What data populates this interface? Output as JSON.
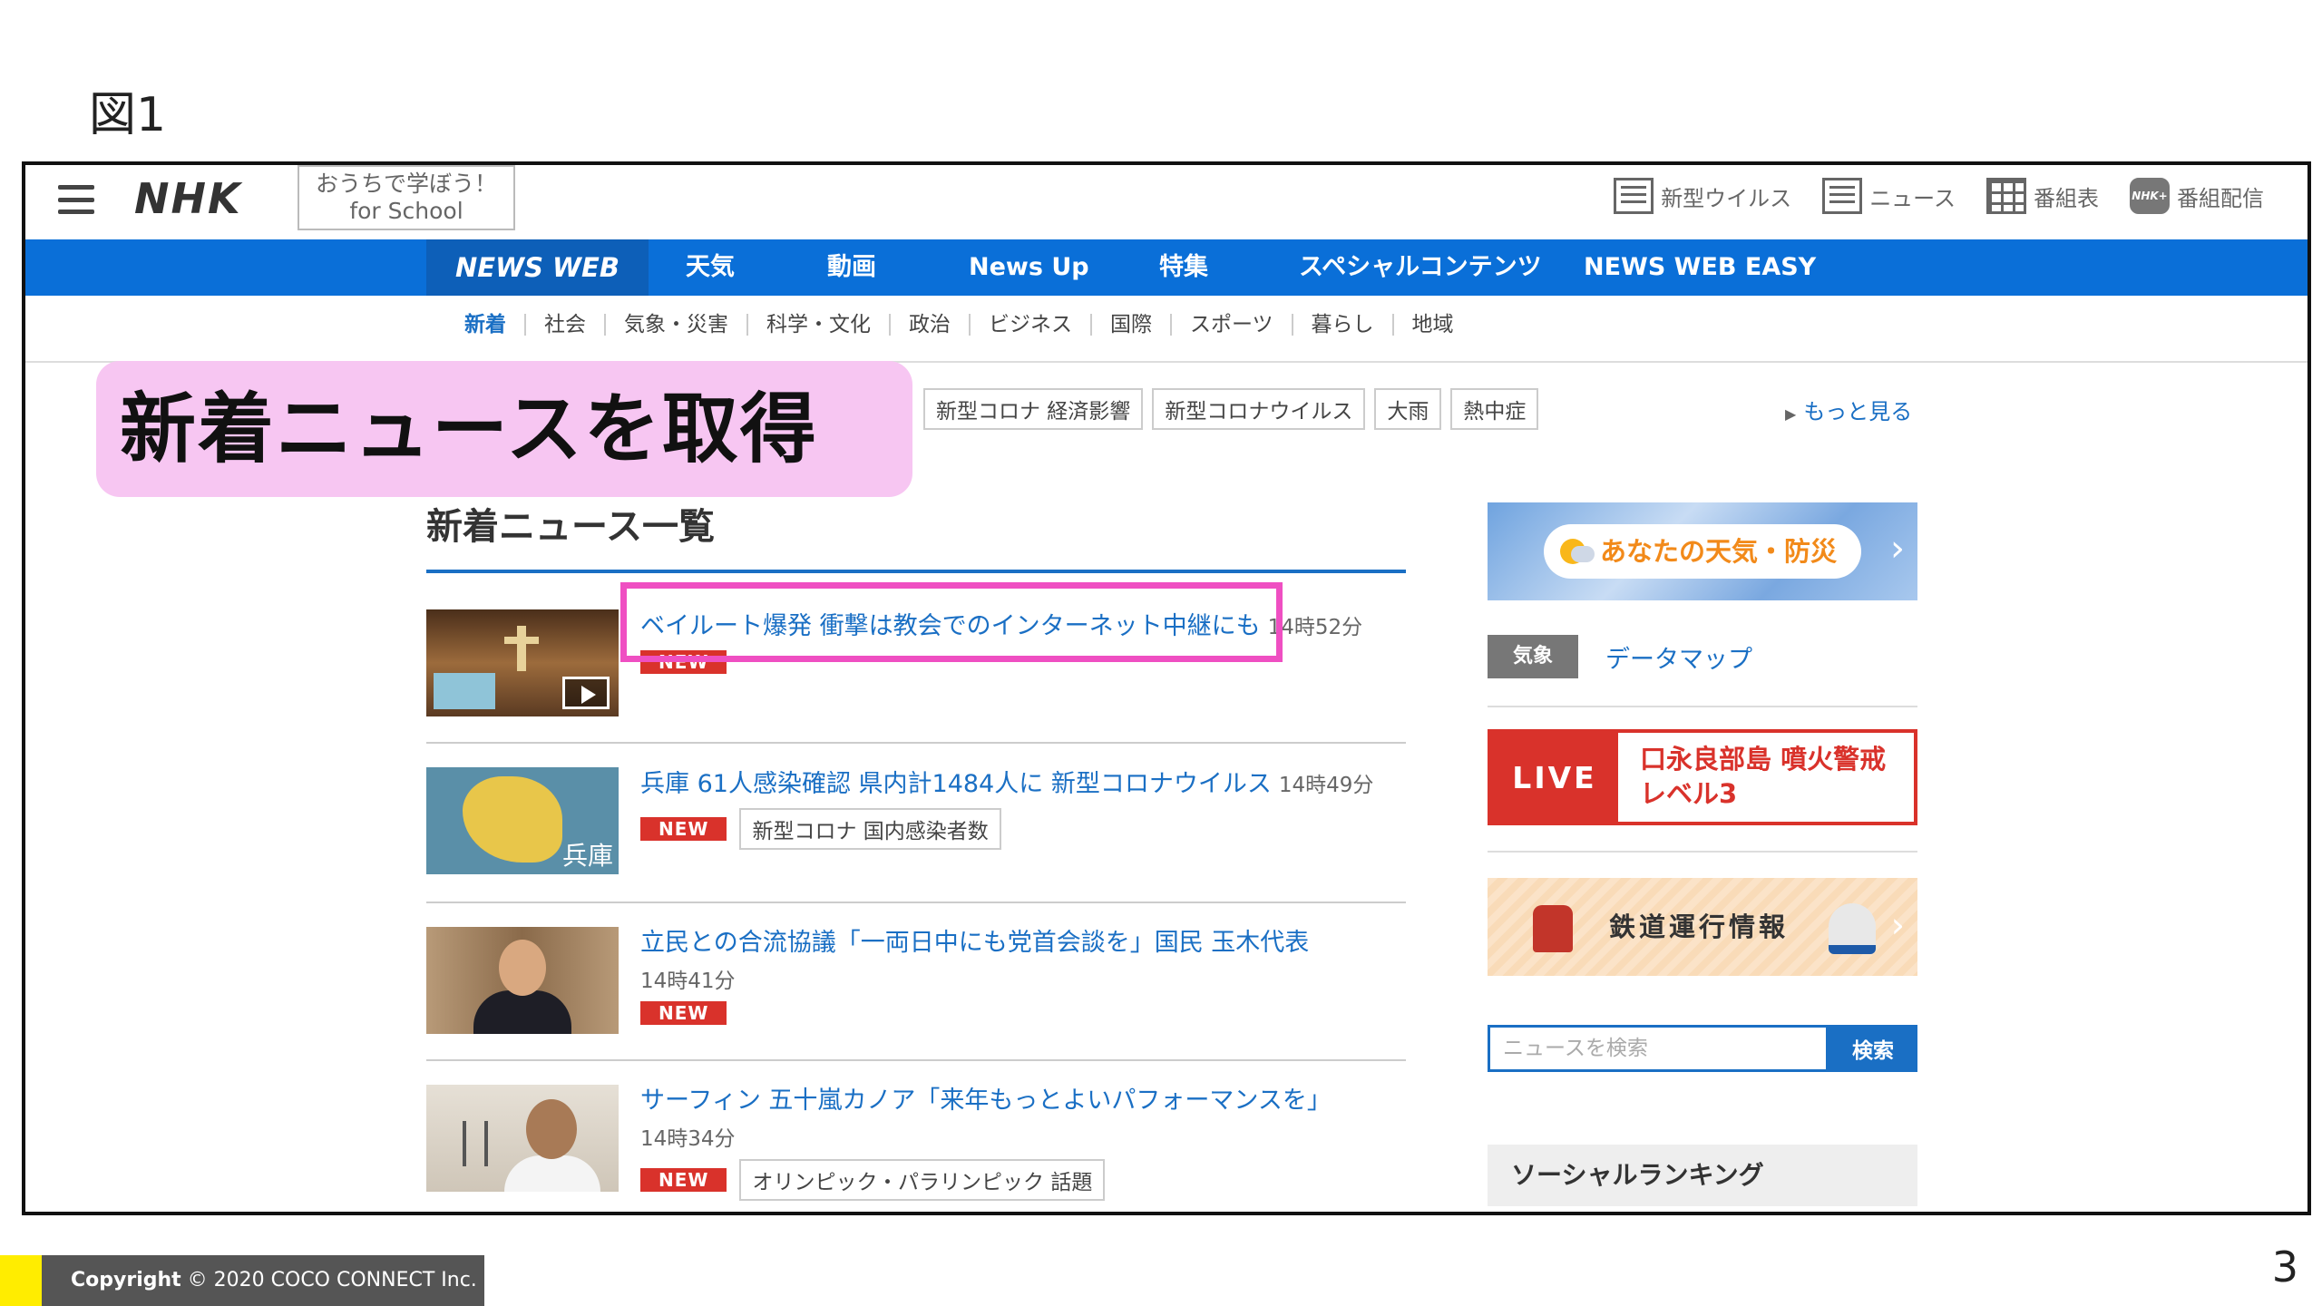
{
  "figure_label": "図1",
  "header": {
    "logo": "NHK",
    "school_line1": "おうちで学ぼう！",
    "school_line2": "for School",
    "links": [
      "新型ウイルス",
      "ニュース",
      "番組表",
      "番組配信"
    ],
    "stream_icon_text": "NHK+"
  },
  "nav": {
    "items": [
      "NEWS WEB",
      "天気",
      "動画",
      "News Up",
      "特集",
      "スペシャルコンテンツ",
      "NEWS WEB EASY"
    ]
  },
  "subnav": {
    "items": [
      "新着",
      "社会",
      "気象・災害",
      "科学・文化",
      "政治",
      "ビジネス",
      "国際",
      "スポーツ",
      "暮らし",
      "地域"
    ]
  },
  "tags": {
    "items": [
      "新型コロナ 経済影響",
      "新型コロナウイルス",
      "大雨",
      "熱中症"
    ],
    "more": "もっと見る"
  },
  "callout": "新着ニュースを取得",
  "list": {
    "title": "新着ニュース一覧",
    "new_label": "NEW",
    "items": [
      {
        "headline": "ベイルート爆発 衝撃は教会でのインターネット中継にも",
        "time": "14時52分",
        "category": ""
      },
      {
        "headline": "兵庫 61人感染確認 県内計1484人に 新型コロナウイルス",
        "time": "14時49分",
        "category": "新型コロナ 国内感染者数",
        "thumb_label": "兵庫"
      },
      {
        "headline": "立民との合流協議「一両日中にも党首会談を」国民 玉木代表",
        "time": "14時41分",
        "category": ""
      },
      {
        "headline": "サーフィン 五十嵐カノア「来年もっとよいパフォーマンスを」",
        "time": "14時34分",
        "category": "オリンピック・パラリンピック 話題"
      }
    ]
  },
  "sidebar": {
    "weather": "あなたの天気・防災",
    "datamap_badge": "気象",
    "datamap_link": "データマップ",
    "live_label": "LIVE",
    "live_text": "口永良部島 噴火警戒レベル3",
    "rail": "鉄道運行情報",
    "search_placeholder": "ニュースを検索",
    "search_button": "検索",
    "social": "ソーシャルランキング"
  },
  "footer": {
    "copyright_bold": "Copyright",
    "copyright_rest": "© 2020 COCO CONNECT Inc.",
    "page": "3"
  }
}
